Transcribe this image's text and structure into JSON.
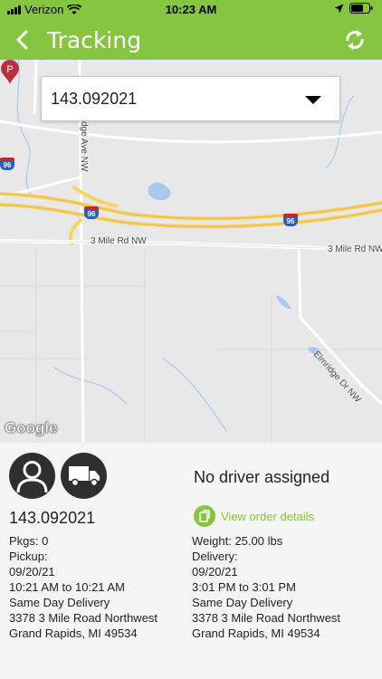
{
  "status_bar": {
    "carrier": "Verizon",
    "time": "10:23 AM",
    "icons": [
      "signal-icon",
      "wifi-icon",
      "location-arrow-icon",
      "battery-icon"
    ]
  },
  "nav": {
    "title": "Tracking",
    "back_icon": "chevron-left-icon",
    "refresh_icon": "refresh-icon"
  },
  "map": {
    "order_select_value": "143.092021",
    "roads": {
      "road_a": "3 Mile Rd NW",
      "road_b": "3 Mile Rd NW",
      "road_c": "Elmridge Dr NW",
      "road_d": "dge Ave NW"
    },
    "highway_shields": [
      "96",
      "96",
      "96"
    ],
    "attribution": "Google",
    "pin_letter": "P"
  },
  "details": {
    "driver_status": "No driver assigned",
    "order_number": "143.092021",
    "view_order_label": "View order details",
    "pickup": {
      "pkgs": "Pkgs: 0",
      "label": "Pickup:",
      "date": "09/20/21",
      "time": "10:21 AM to 10:21 AM",
      "service": "Same Day Delivery",
      "address": "3378 3 Mile Road Northwest",
      "city": "Grand Rapids, MI 49534"
    },
    "delivery": {
      "weight": "Weight: 25.00 lbs",
      "label": "Delivery:",
      "date": "09/20/21",
      "time": "3:01 PM to 3:01 PM",
      "service": "Same Day Delivery",
      "address": "3378 3 Mile Road Northwest",
      "city": "Grand Rapids, MI 49534"
    }
  },
  "colors": {
    "brand_green": "#86c540",
    "pin_red": "#b8323c",
    "highway_yellow": "#f6d365"
  }
}
